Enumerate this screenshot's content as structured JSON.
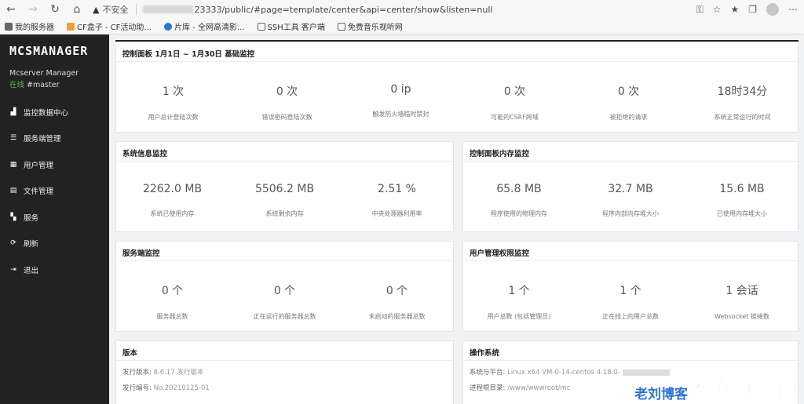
{
  "browser": {
    "insecure_label": "不安全",
    "url_rest": "23333/public/#page=template/center&api=center/show&listen=null",
    "bookmarks": [
      "我的服务器",
      "CF盒子 - CF活动助...",
      "片库 - 全网高清影...",
      "SSH工具 客户端",
      "免费音乐视听网"
    ]
  },
  "sidebar": {
    "logo": "MCSMANAGER",
    "subtitle": "Mcserver Manager",
    "status_online": "在线",
    "status_user": "#master",
    "menu": [
      {
        "label": "监控数据中心",
        "icon": "chart-icon"
      },
      {
        "label": "服务端管理",
        "icon": "server-icon"
      },
      {
        "label": "用户管理",
        "icon": "grid-icon"
      },
      {
        "label": "文件管理",
        "icon": "list-icon"
      },
      {
        "label": "服务",
        "icon": "tool-icon"
      },
      {
        "label": "刷新",
        "icon": "refresh-icon"
      },
      {
        "label": "退出",
        "icon": "logout-icon"
      }
    ]
  },
  "panels": {
    "basic": {
      "title": "控制面板 1月1日 ~ 1月30日 基础监控",
      "stats": [
        {
          "value": "1 次",
          "label": "用户总计登陆次数"
        },
        {
          "value": "0 次",
          "label": "错误密码登陆次数"
        },
        {
          "value": "0 ip",
          "label": "触发防火墙临时禁封"
        },
        {
          "value": "0 次",
          "label": "可能的CSRF跨域"
        },
        {
          "value": "0 次",
          "label": "被拒绝的请求"
        },
        {
          "value": "18时34分",
          "label": "系统正常运行的时间"
        }
      ]
    },
    "system": {
      "title": "系统信息监控",
      "stats": [
        {
          "value": "2262.0 MB",
          "label": "系统已使用内存"
        },
        {
          "value": "5506.2 MB",
          "label": "系统剩余内存"
        },
        {
          "value": "2.51 %",
          "label": "中央处理器利用率"
        }
      ]
    },
    "memory": {
      "title": "控制面板内存监控",
      "stats": [
        {
          "value": "65.8 MB",
          "label": "程序使用的物理内存"
        },
        {
          "value": "32.7 MB",
          "label": "程序内部内存堆大小"
        },
        {
          "value": "15.6 MB",
          "label": "已使用内存堆大小"
        }
      ]
    },
    "server": {
      "title": "服务端监控",
      "stats": [
        {
          "value": "0 个",
          "label": "服务器总数"
        },
        {
          "value": "0 个",
          "label": "正在运行的服务器总数"
        },
        {
          "value": "0 个",
          "label": "未启动的服务器总数"
        }
      ]
    },
    "users": {
      "title": "用户管理权限监控",
      "stats": [
        {
          "value": "1 个",
          "label": "用户总数 (包括管理员)"
        },
        {
          "value": "1 个",
          "label": "正在线上的用户总数"
        },
        {
          "value": "1 会话",
          "label": "Websocket 链接数"
        }
      ]
    },
    "version": {
      "title": "版本",
      "rows": [
        {
          "key": "发行版本:",
          "value": "8.6.17 发行版本"
        },
        {
          "key": "发行编号:",
          "value": "No.20210125-01"
        }
      ]
    },
    "os": {
      "title": "操作系统",
      "rows": [
        {
          "key": "系统与平台:",
          "value": "Linux x64 VM-0-14-centos 4.18.0-"
        },
        {
          "key": "进程根目录:",
          "value": "/www/wwwroot/mc"
        }
      ]
    }
  },
  "watermark": {
    "small": "老刘博客",
    "big": "优乐评测网"
  }
}
